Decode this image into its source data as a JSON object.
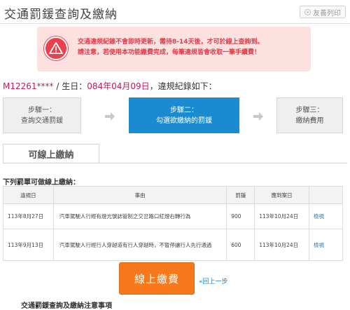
{
  "header": {
    "title": "交通罰鍰查詢及繳納",
    "print_label": "友善列印"
  },
  "alert": {
    "icon": "warning-icon",
    "line1": "交通違規紀錄不會即時更新，需待8-14天後，才可於線上查詢到。",
    "line2": "請注意，若使用本功能繳費完成，每筆違規皆會收取一筆手續費！"
  },
  "identity": {
    "plate": "M12261****",
    "separator": " / ",
    "birth_label": "生日：",
    "birth_value": "084年04月09日",
    "suffix": "，違規紀錄如下："
  },
  "steps": [
    {
      "line1": "步驟一：",
      "line2": "查詢交通罰鍰"
    },
    {
      "line1": "步驟二：",
      "line2": "勾選欲繳納的罰鍰"
    },
    {
      "line1": "步驟三：",
      "line2": "繳納費用"
    }
  ],
  "tab": {
    "label": "可線上繳納"
  },
  "list_heading": "下列罰單可做線上繳納：",
  "table": {
    "headers": [
      "違規日",
      "事由",
      "罰鍰",
      "應到案日",
      ""
    ],
    "rows": [
      {
        "date": "113年8月27日",
        "reason": "汽車駕駛人行經有燈光號誌管制之交岔路口紅燈右轉行為",
        "amount": "900",
        "due": "113年10月24日",
        "action": "檢視"
      },
      {
        "date": "113年9月13日",
        "reason": "汽車駕駛人行經行人穿越道有行人穿越時，不暫停讓行人先行通過",
        "amount": "600",
        "due": "113年10月24日",
        "action": "檢視"
      }
    ]
  },
  "actions": {
    "pay_label": "線上繳費",
    "back_label": "«回上一步"
  },
  "notes_title": "交通罰鍰查詢及繳納注意事項",
  "colors": {
    "accent_blue": "#1a8bd0",
    "pay_orange": "#f7791b",
    "alert_bg": "#fde1e1",
    "alert_red": "#e23c48"
  }
}
